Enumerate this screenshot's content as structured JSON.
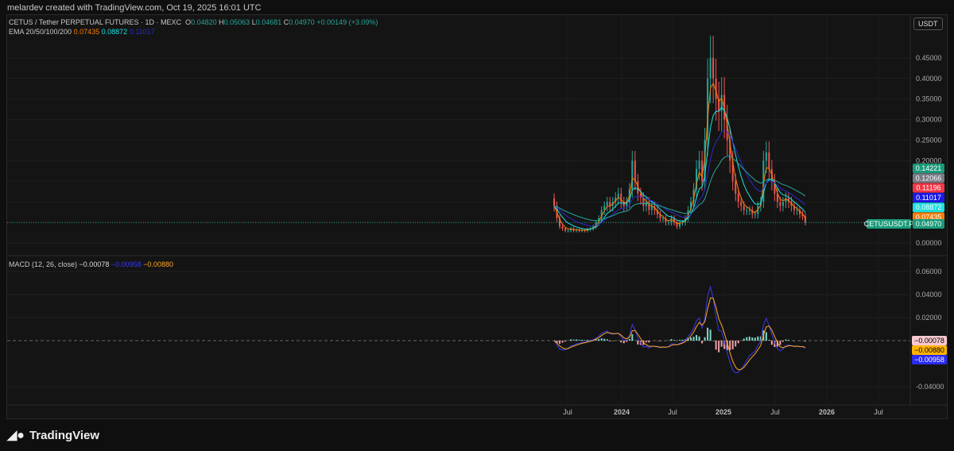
{
  "credit": "melardev created with TradingView.com, Oct 19, 2025 16:01 UTC",
  "header": {
    "symbol": "CETUS / Tether PERPETUAL FUTURES · 1D · MEXC",
    "o_label": "O",
    "o": "0.04820",
    "h_label": "H",
    "h": "0.05063",
    "l_label": "L",
    "l": "0.04681",
    "c_label": "C",
    "c": "0.04970",
    "change": "+0.00149 (+3.09%)",
    "currency": "USDT"
  },
  "ema": {
    "label": "EMA 20/50/100/200",
    "v1": "0.07435",
    "v2": "0.08872",
    "v3": "0.11017"
  },
  "macd": {
    "label": "MACD (12, 26, close)",
    "hist": "−0.00078",
    "macd": "−0.00958",
    "signal": "−0.00880"
  },
  "price_labels": [
    {
      "text": "0.14221",
      "color": "#1a9a7a"
    },
    {
      "text": "0.12066",
      "color": "#787b86"
    },
    {
      "text": "0.11196",
      "color": "#f23645"
    },
    {
      "text": "0.11017",
      "color": "#1a1ae6"
    },
    {
      "text": "0.08872",
      "color": "#1ee0e0"
    },
    {
      "text": "0.07435",
      "color": "#f57c00"
    }
  ],
  "last_price": {
    "symbol": "CETUSUSDT.P",
    "value": "0.04970",
    "color": "#1a9a7a"
  },
  "macd_labels": [
    {
      "text": "−0.00078",
      "color": "#f8c8d0",
      "fg": "#000"
    },
    {
      "text": "−0.00880",
      "color": "#ffb300",
      "fg": "#000"
    },
    {
      "text": "−0.00958",
      "color": "#2a2af0",
      "fg": "#fff"
    }
  ],
  "footer": {
    "brand": "TradingView"
  },
  "chart_data": {
    "type": "candlestick",
    "title": "CETUS / Tether PERPETUAL FUTURES · 1D · MEXC",
    "price_axis": {
      "ticks": [
        "0.45000",
        "0.40000",
        "0.35000",
        "0.30000",
        "0.25000",
        "0.20000",
        "0.00000"
      ],
      "values": [
        0.45,
        0.4,
        0.35,
        0.3,
        0.25,
        0.2,
        0.0
      ],
      "ylim": [
        0,
        0.5
      ]
    },
    "macd_axis": {
      "ticks": [
        "0.06000",
        "0.04000",
        "0.02000",
        "-0.04000"
      ],
      "values": [
        0.06,
        0.04,
        0.02,
        -0.04
      ],
      "ylim": [
        -0.045,
        0.065
      ]
    },
    "time_ticks": [
      "Jul",
      "2024",
      "Jul",
      "2025",
      "Jul",
      "2026",
      "Jul"
    ],
    "weekly_closes": [
      0.09,
      0.06,
      0.04,
      0.035,
      0.03,
      0.03,
      0.035,
      0.03,
      0.032,
      0.03,
      0.031,
      0.03,
      0.033,
      0.035,
      0.04,
      0.05,
      0.06,
      0.08,
      0.09,
      0.1,
      0.09,
      0.1,
      0.11,
      0.12,
      0.1,
      0.09,
      0.1,
      0.13,
      0.2,
      0.15,
      0.12,
      0.11,
      0.09,
      0.1,
      0.08,
      0.09,
      0.08,
      0.07,
      0.06,
      0.06,
      0.05,
      0.05,
      0.06,
      0.05,
      0.04,
      0.05,
      0.05,
      0.06,
      0.08,
      0.1,
      0.13,
      0.18,
      0.2,
      0.15,
      0.25,
      0.4,
      0.45,
      0.4,
      0.35,
      0.32,
      0.36,
      0.3,
      0.25,
      0.2,
      0.15,
      0.12,
      0.1,
      0.09,
      0.08,
      0.08,
      0.08,
      0.07,
      0.07,
      0.09,
      0.1,
      0.2,
      0.22,
      0.18,
      0.15,
      0.12,
      0.1,
      0.09,
      0.1,
      0.11,
      0.1,
      0.09,
      0.08,
      0.08,
      0.07,
      0.065,
      0.05
    ]
  }
}
